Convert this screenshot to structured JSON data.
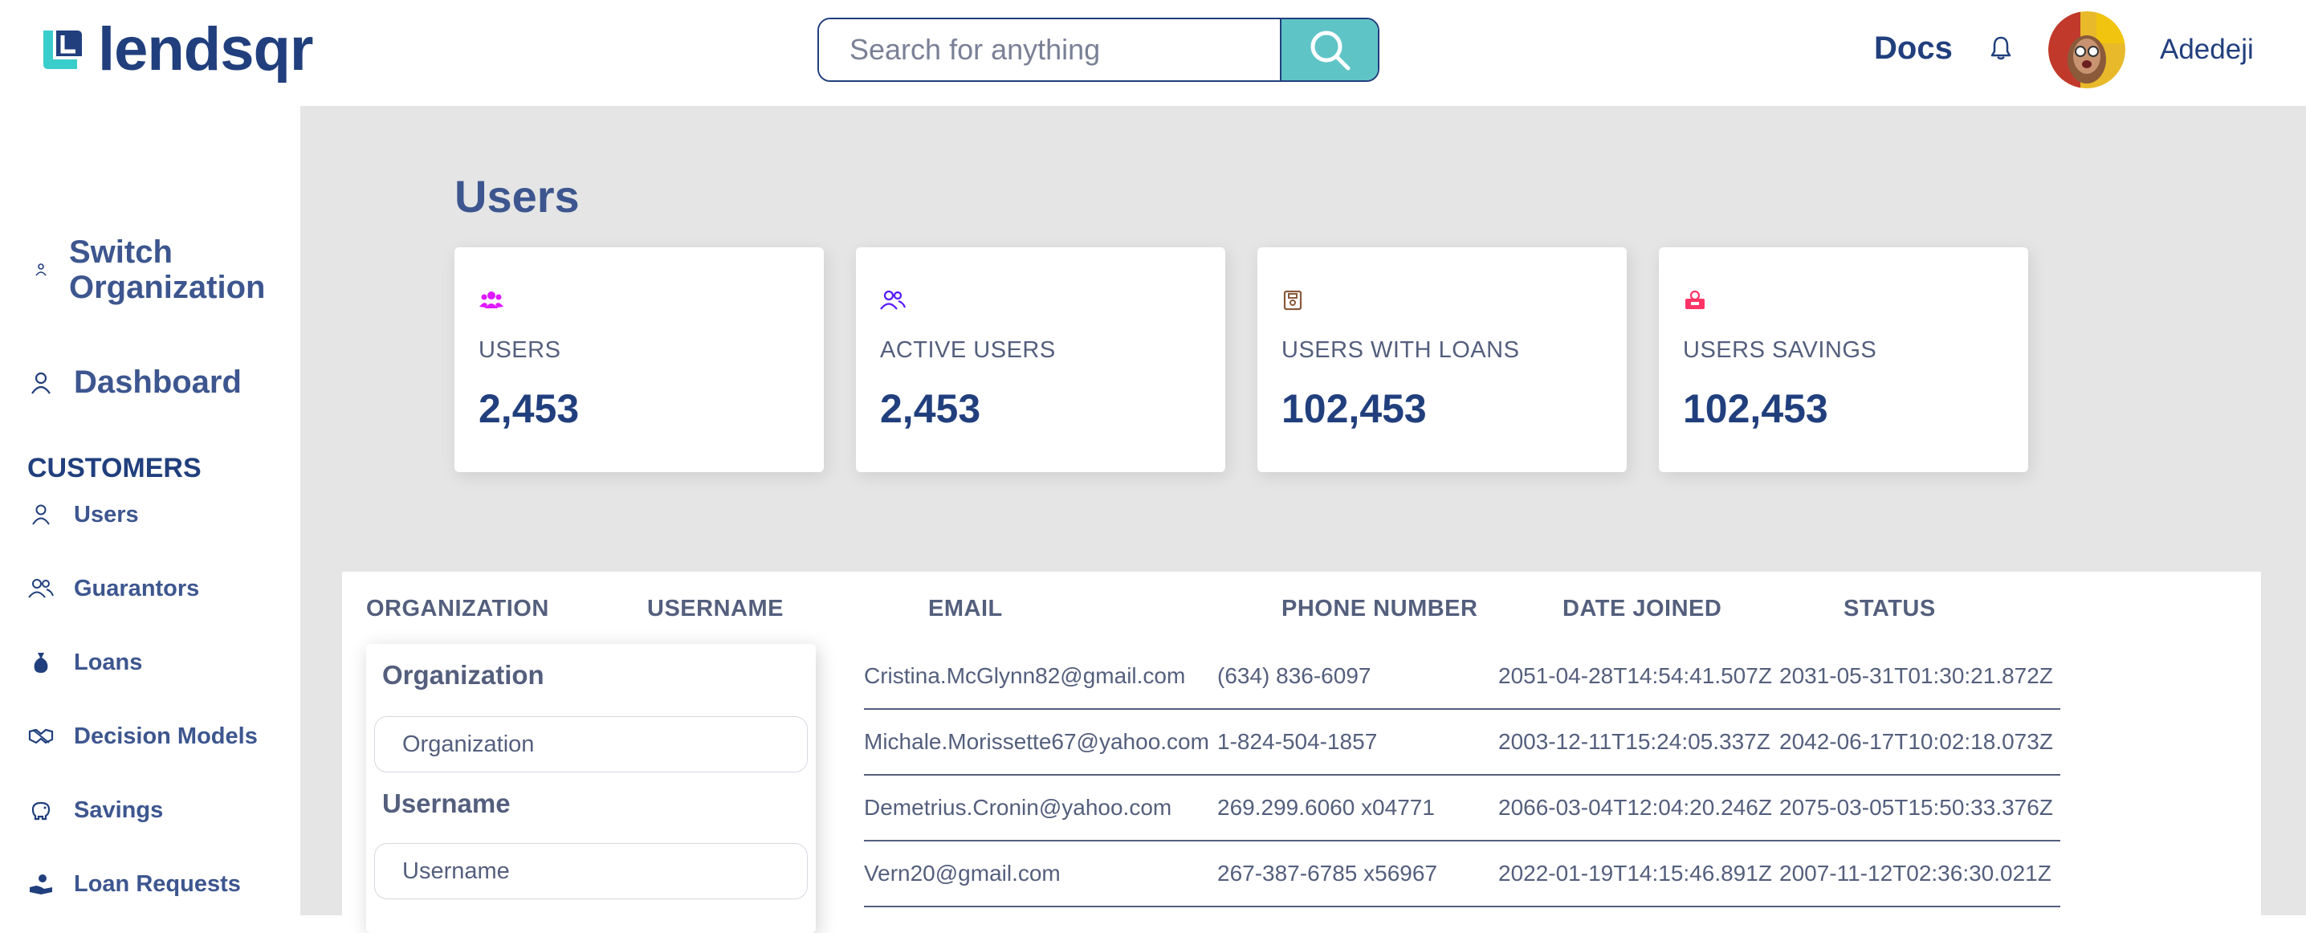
{
  "header": {
    "logo_text": "lendsqr",
    "search_placeholder": "Search for anything",
    "docs_label": "Docs",
    "user_name": "Adedeji"
  },
  "sidebar": {
    "switch_org_line1": "Switch",
    "switch_org_line2": "Organization",
    "dashboard_label": "Dashboard",
    "section_title": "CUSTOMERS",
    "items": [
      {
        "label": "Users",
        "icon": "user-icon"
      },
      {
        "label": "Guarantors",
        "icon": "users-icon"
      },
      {
        "label": "Loans",
        "icon": "sack-icon"
      },
      {
        "label": "Decision Models",
        "icon": "handshake-icon"
      },
      {
        "label": "Savings",
        "icon": "piggy-bank-icon"
      },
      {
        "label": "Loan Requests",
        "icon": "hand-coin-icon"
      }
    ]
  },
  "main": {
    "page_title": "Users",
    "cards": [
      {
        "label": "USERS",
        "value": "2,453",
        "icon": "users-icon",
        "color": "#DF18FF"
      },
      {
        "label": "ACTIVE USERS",
        "value": "2,453",
        "icon": "active-users-icon",
        "color": "#5718FF"
      },
      {
        "label": "USERS WITH LOANS",
        "value": "102,453",
        "icon": "loan-doc-icon",
        "color": "#F55F44"
      },
      {
        "label": "USERS SAVINGS",
        "value": "102,453",
        "icon": "savings-icon",
        "color": "#FF3366"
      }
    ],
    "table": {
      "headers": [
        "ORGANIZATION",
        "USERNAME",
        "EMAIL",
        "PHONE NUMBER",
        "DATE JOINED",
        "STATUS"
      ],
      "rows": [
        {
          "email": "Cristina.McGlynn82@gmail.com",
          "phone": "(634) 836-6097",
          "date_joined": "2051-04-28T14:54:41.507Z",
          "status": "2031-05-31T01:30:21.872Z"
        },
        {
          "email": "Michale.Morissette67@yahoo.com",
          "phone": "1-824-504-1857",
          "date_joined": "2003-12-11T15:24:05.337Z",
          "status": "2042-06-17T10:02:18.073Z"
        },
        {
          "email": "Demetrius.Cronin@yahoo.com",
          "phone": "269.299.6060 x04771",
          "date_joined": "2066-03-04T12:04:20.246Z",
          "status": "2075-03-05T15:50:33.376Z"
        },
        {
          "email": "Vern20@gmail.com",
          "phone": "267-387-6785 x56967",
          "date_joined": "2022-01-19T14:15:46.891Z",
          "status": "2007-11-12T02:36:30.021Z"
        }
      ]
    },
    "filter": {
      "org_label": "Organization",
      "org_placeholder": "Organization",
      "user_label": "Username",
      "user_placeholder": "Username"
    }
  },
  "colors": {
    "brand_navy": "#213F7D",
    "accent_teal": "#39CDCC",
    "text_grey": "#545F7D",
    "main_bg": "#E5E5E5"
  }
}
